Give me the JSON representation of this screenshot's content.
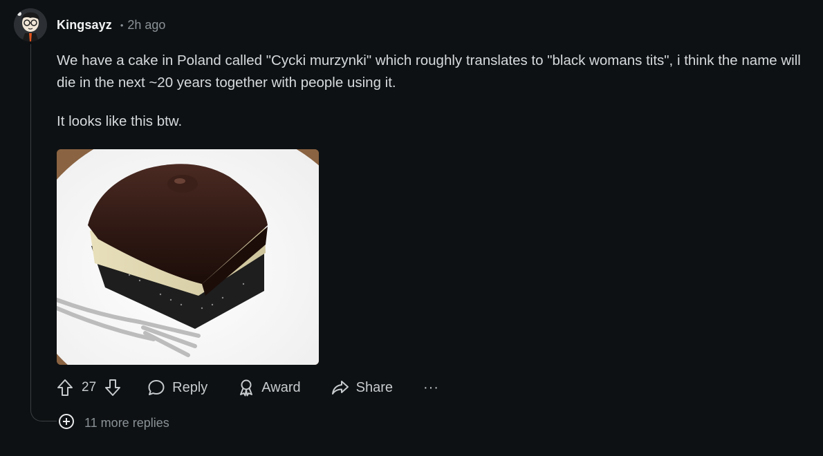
{
  "comment": {
    "username": "Kingsayz",
    "separator": "•",
    "time": "2h ago",
    "paragraphs": [
      "We have a cake in Poland called \"Cycki murzynki\" which roughly translates to \"black womans tits\", i think the name will die in the next ~20 years together with people using it.",
      "It looks like this btw."
    ],
    "image": {
      "icon": "cake-photo"
    }
  },
  "actions": {
    "upvote_icon": "arrow-up-icon",
    "score": "27",
    "downvote_icon": "arrow-down-icon",
    "reply_label": "Reply",
    "award_label": "Award",
    "share_label": "Share",
    "more_label": "···"
  },
  "more_replies": {
    "icon": "plus-circle-icon",
    "label": "11 more replies"
  },
  "colors": {
    "background": "#0e1113",
    "text": "#d7dadc",
    "muted": "#8a9297",
    "thread_line": "#3a3f43"
  }
}
